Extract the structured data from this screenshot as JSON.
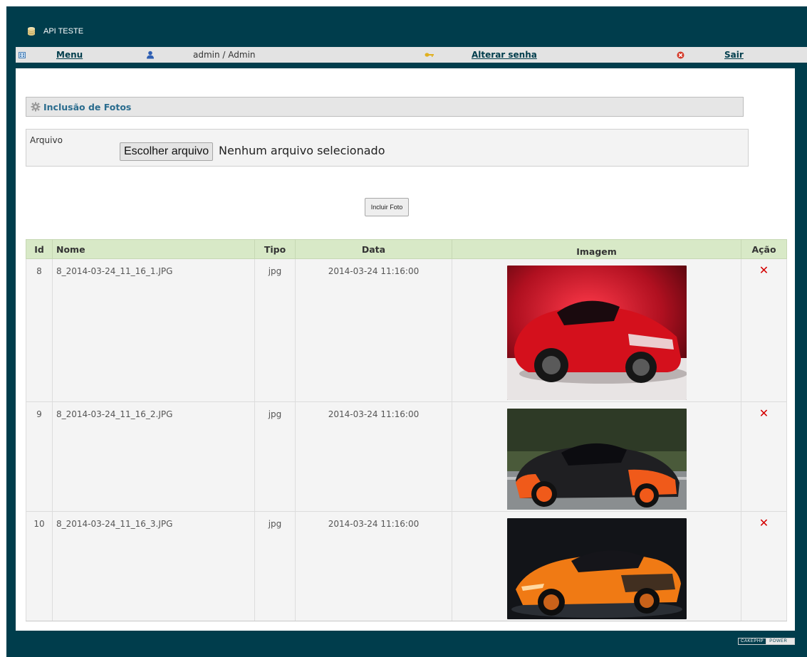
{
  "app": {
    "title": "API TESTE"
  },
  "menubar": {
    "menu_label": "Menu",
    "user_label": "admin / Admin",
    "change_password_label": "Alterar senha",
    "logout_label": "Sair"
  },
  "section": {
    "title": "Inclusão de Fotos"
  },
  "form": {
    "file_label": "Arquivo",
    "file_button_label": "Escolher arquivo",
    "file_status": "Nenhum arquivo selecionado",
    "submit_label": "Incluir Foto"
  },
  "table": {
    "headers": {
      "id": "Id",
      "nome": "Nome",
      "tipo": "Tipo",
      "data": "Data",
      "imagem": "Imagem",
      "acao": "Ação"
    },
    "rows": [
      {
        "id": "8",
        "nome": "8_2014-03-24_11_16_1.JPG",
        "tipo": "jpg",
        "data": "2014-03-24 11:16:00",
        "image": "red-sports-car",
        "action": "✕"
      },
      {
        "id": "9",
        "nome": "8_2014-03-24_11_16_2.JPG",
        "tipo": "jpg",
        "data": "2014-03-24 11:16:00",
        "image": "black-orange-supercar",
        "action": "✕"
      },
      {
        "id": "10",
        "nome": "8_2014-03-24_11_16_3.JPG",
        "tipo": "jpg",
        "data": "2014-03-24 11:16:00",
        "image": "orange-supercar",
        "action": "✕"
      }
    ]
  },
  "footer": {
    "badge_left": "CAKEPHP",
    "badge_right": "POWER"
  },
  "colors": {
    "frame": "#003d4c",
    "menubar": "#e3e3e3",
    "table_header": "#d8e9c7",
    "section_title": "#2a6c8e",
    "delete": "#d40000"
  }
}
